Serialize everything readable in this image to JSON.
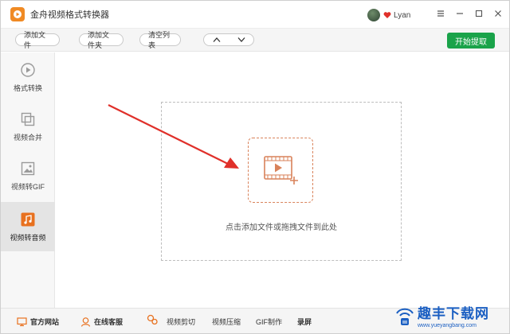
{
  "app": {
    "title": "金舟视频格式转换器",
    "username": "Lyan"
  },
  "toolbar": {
    "add_file": "添加文件",
    "add_folder": "添加文件夹",
    "clear_list": "清空列表",
    "start": "开始提取"
  },
  "sidebar": {
    "items": [
      {
        "label": "格式转换",
        "icon": "format-convert-icon",
        "active": false
      },
      {
        "label": "视频合并",
        "icon": "video-merge-icon",
        "active": false
      },
      {
        "label": "视频转GIF",
        "icon": "video-gif-icon",
        "active": false
      },
      {
        "label": "视频转音频",
        "icon": "music-note-icon",
        "active": true
      }
    ]
  },
  "main": {
    "drop_text": "点击添加文件或拖拽文件到此处"
  },
  "bottombar": {
    "items": [
      {
        "label": "官方网站",
        "icon": "website-icon"
      },
      {
        "label": "在线客服",
        "icon": "support-icon"
      },
      {
        "label": "视频剪切",
        "icon": "tools-icon"
      },
      {
        "label": "视频压缩",
        "icon": ""
      },
      {
        "label": "GIF制作",
        "icon": ""
      },
      {
        "label": "录屏",
        "icon": ""
      }
    ]
  },
  "watermark": {
    "main": "趣丰下载网",
    "sub": "www.yueyangbang.com"
  },
  "colors": {
    "accent_green": "#1aa34a",
    "accent_orange": "#f08a24",
    "drop_icon": "#d9825a",
    "annotation_arrow": "#e0302a",
    "watermark_blue": "#1b5fc2"
  }
}
